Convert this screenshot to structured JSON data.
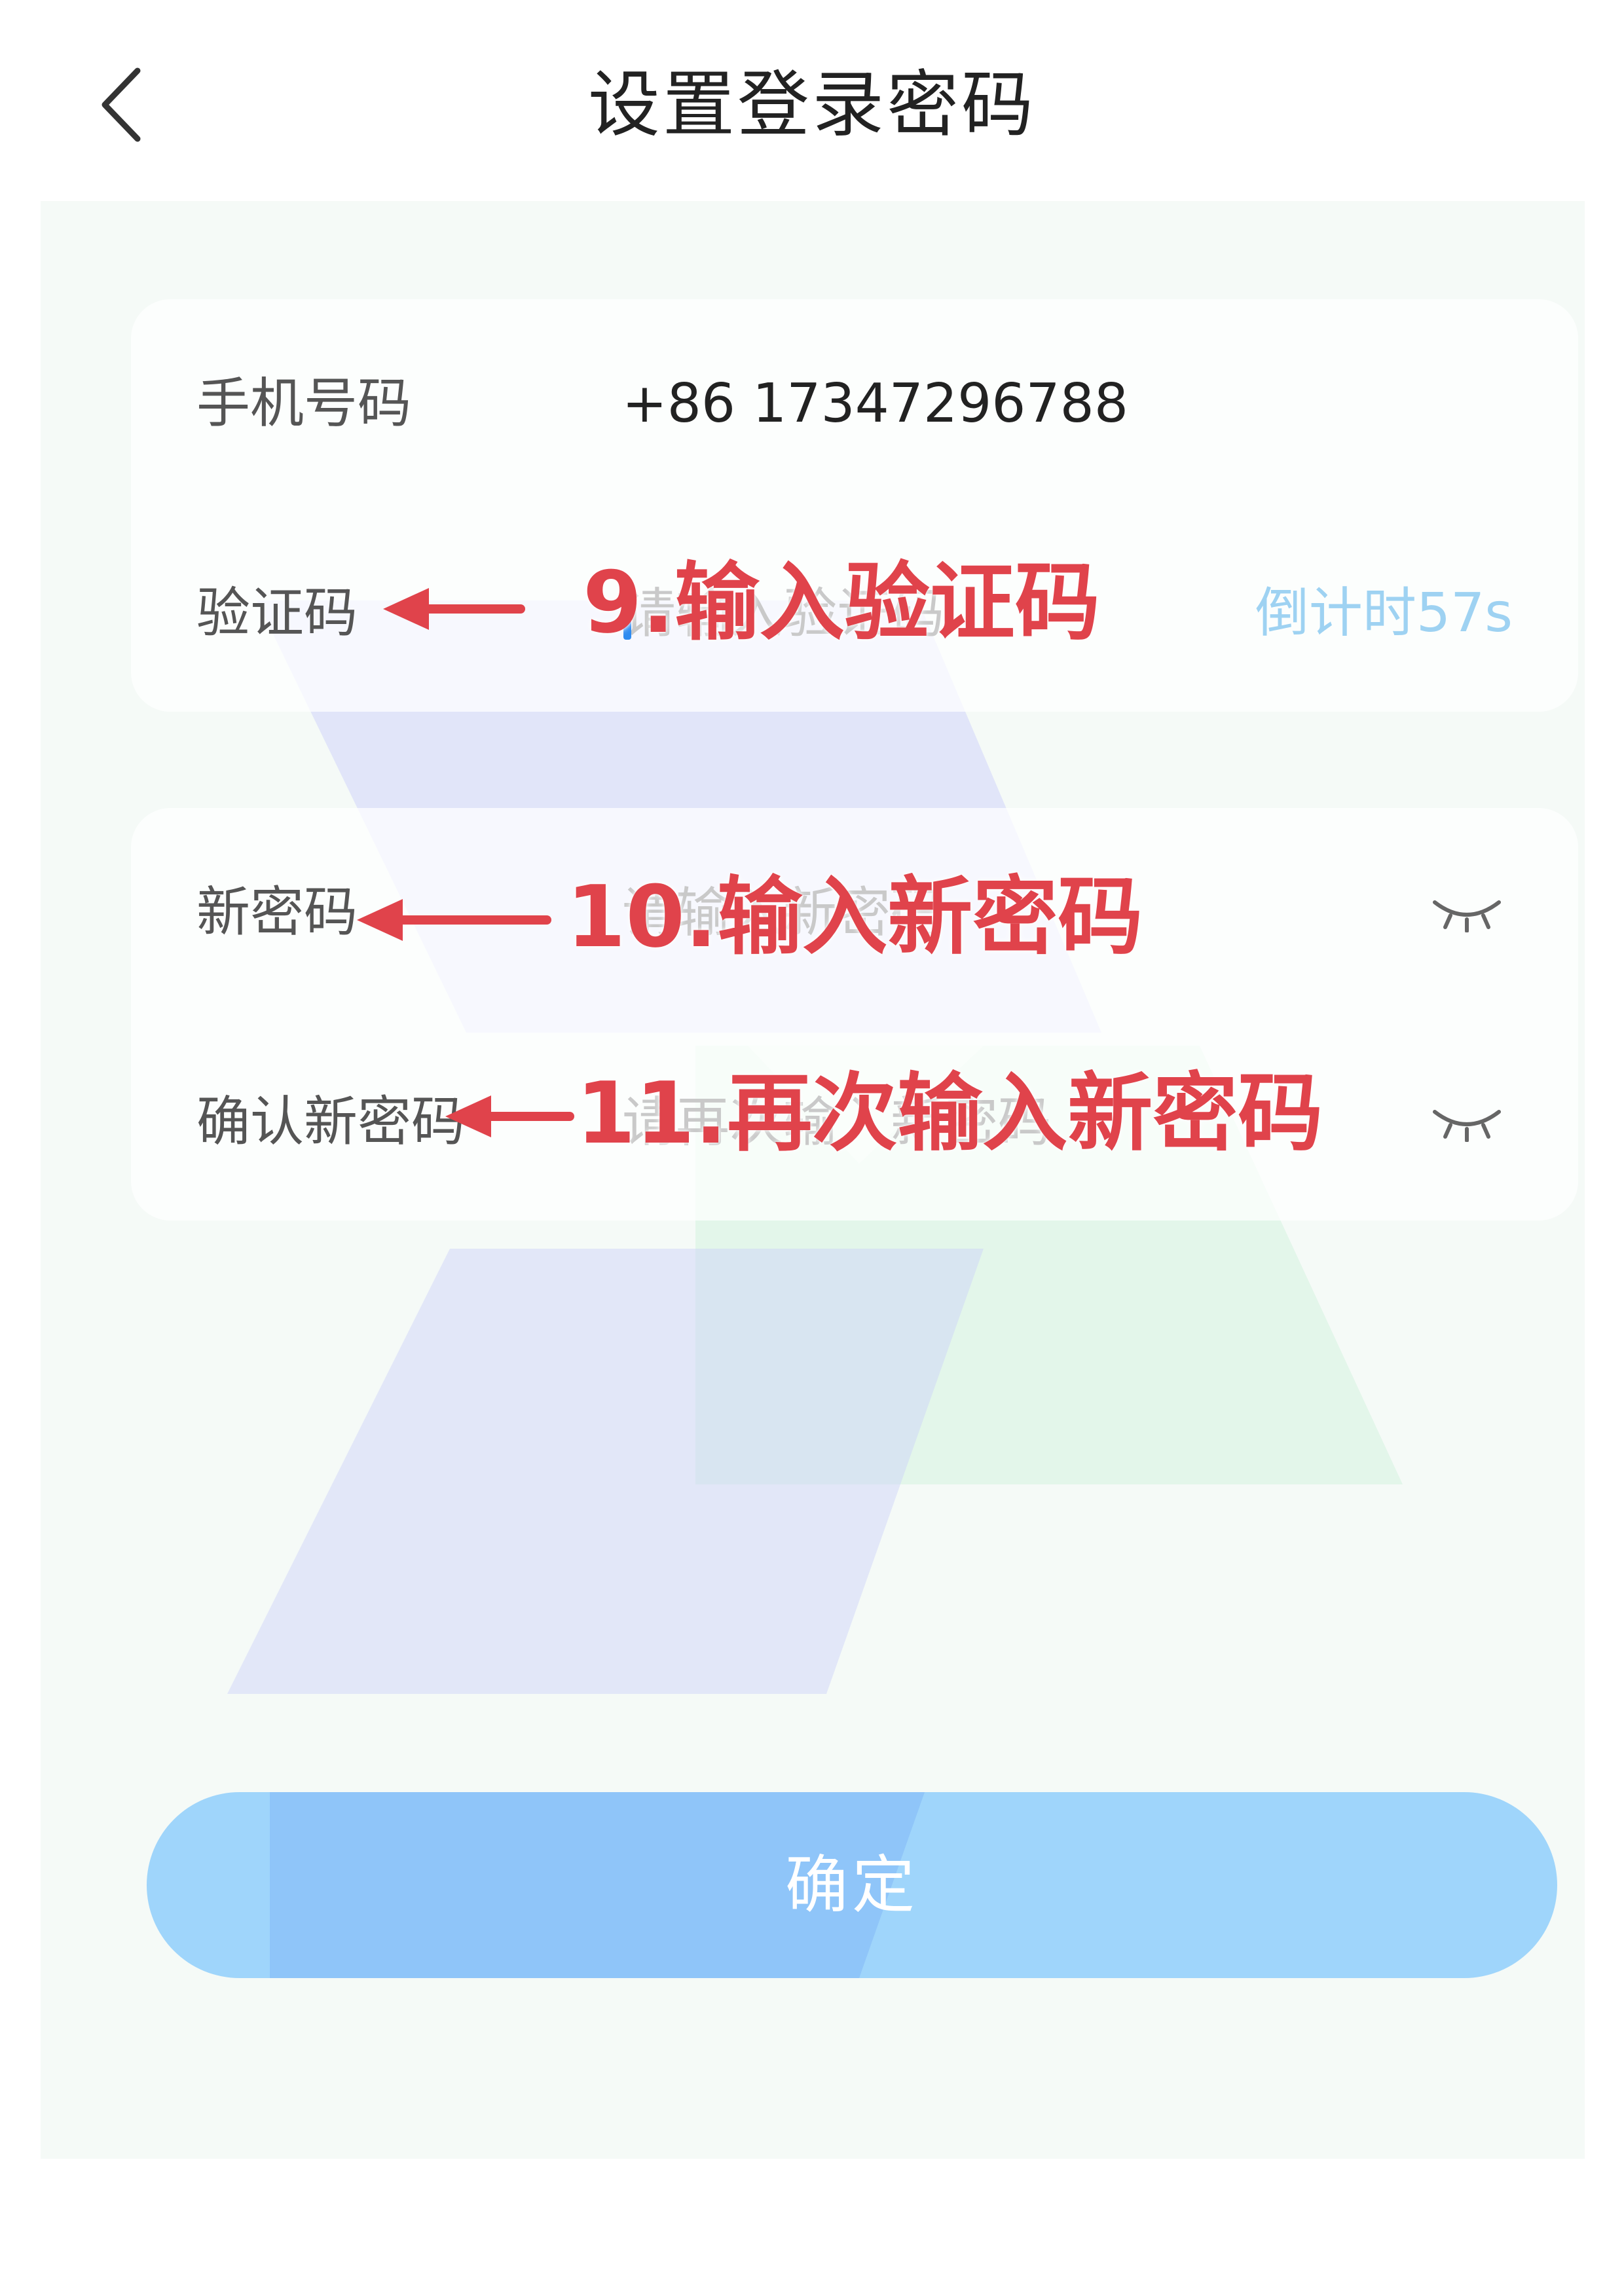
{
  "header": {
    "title": "设置登录密码"
  },
  "form": {
    "phone": {
      "label": "手机号码",
      "value": "+86 17347296788"
    },
    "code": {
      "label": "验证码",
      "placeholder": "请输入验证码",
      "countdown": "倒计时57s"
    },
    "new_password": {
      "label": "新密码",
      "placeholder": "请输入新密码"
    },
    "confirm_password": {
      "label": "确认新密码",
      "placeholder": "请再次输入新密码"
    }
  },
  "submit": {
    "label": "确定"
  },
  "annotations": {
    "step9": "9.输入验证码",
    "step10": "10.输入新密码",
    "step11": "11.再次输入新密码"
  },
  "colors": {
    "accent": "#2e8bf0",
    "button": "#9fd5fb",
    "countdown": "#9ed2f2",
    "annotation": "#e0434b",
    "background": "#f5faf7"
  },
  "icons": {
    "back": "chevron-left-icon",
    "eye_closed": "eye-closed-icon"
  }
}
